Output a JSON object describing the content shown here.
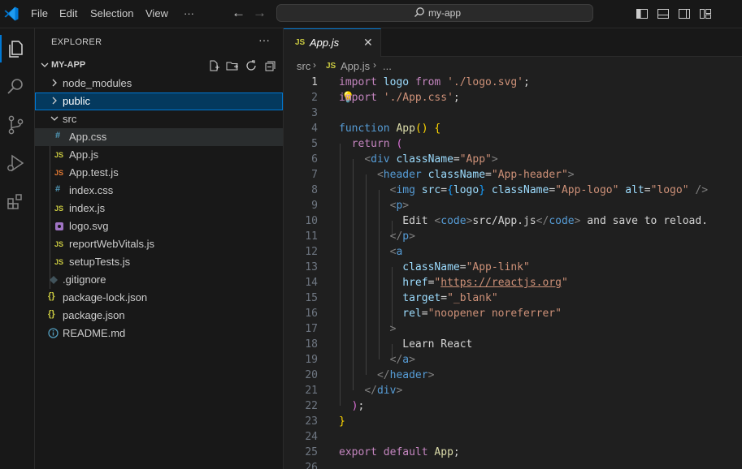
{
  "titlebar": {
    "menu": [
      "File",
      "Edit",
      "Selection",
      "View"
    ],
    "more": "···",
    "search_text": "my-app"
  },
  "explorer": {
    "title": "EXPLORER",
    "more": "···",
    "folder": "MY-APP",
    "items": [
      {
        "name": "node_modules",
        "type": "folder",
        "icon": "chevron-right"
      },
      {
        "name": "public",
        "type": "folder",
        "icon": "chevron-right"
      },
      {
        "name": "src",
        "type": "folder",
        "icon": "chevron-down"
      },
      {
        "name": "App.css",
        "type": "css",
        "icon": "#"
      },
      {
        "name": "App.js",
        "type": "js",
        "icon": "JS"
      },
      {
        "name": "App.test.js",
        "type": "test",
        "icon": "JS"
      },
      {
        "name": "index.css",
        "type": "css",
        "icon": "#"
      },
      {
        "name": "index.js",
        "type": "js",
        "icon": "JS"
      },
      {
        "name": "logo.svg",
        "type": "svg",
        "icon": "svg-icon"
      },
      {
        "name": "reportWebVitals.js",
        "type": "js",
        "icon": "JS"
      },
      {
        "name": "setupTests.js",
        "type": "js",
        "icon": "JS"
      },
      {
        "name": ".gitignore",
        "type": "git",
        "icon": "git-icon"
      },
      {
        "name": "package-lock.json",
        "type": "json",
        "icon": "{}"
      },
      {
        "name": "package.json",
        "type": "json",
        "icon": "{}"
      },
      {
        "name": "README.md",
        "type": "info",
        "icon": "info-icon"
      }
    ]
  },
  "tab": {
    "badge": "JS",
    "label": "App.js",
    "close": "✕"
  },
  "breadcrumb": {
    "folder": "src",
    "badge": "JS",
    "file": "App.js",
    "more": "..."
  },
  "editor": {
    "current_line": 1,
    "line_numbers": [
      "1",
      "2",
      "3",
      "4",
      "5",
      "6",
      "7",
      "8",
      "9",
      "10",
      "11",
      "12",
      "13",
      "14",
      "15",
      "16",
      "17",
      "18",
      "19",
      "20",
      "21",
      "22",
      "23",
      "24",
      "25",
      "26"
    ],
    "code": {
      "import_kw": "import",
      "logo_var": "logo",
      "from_kw": "from",
      "logo_path": "'./logo.svg'",
      "semi": ";",
      "import2_kw": "import",
      "css_path": "'./App.css'",
      "function_kw": "function",
      "app_fn": "App",
      "open_paren": "(",
      "close_paren": ")",
      "open_brace": "{",
      "return_kw": "return",
      "div_tag": "div",
      "classname_attr": "className",
      "app_class": "\"App\"",
      "header_tag": "header",
      "header_class": "\"App-header\"",
      "img_tag": "img",
      "src_attr": "src",
      "logo_class": "\"App-logo\"",
      "alt_attr": "alt",
      "alt_value": "\"logo\"",
      "p_tag": "p",
      "edit_text": "Edit ",
      "code_tag": "code",
      "code_text": "src/App.js",
      "save_text": " and save to reload.",
      "a_tag": "a",
      "link_class": "\"App-link\"",
      "href_attr": "href",
      "href_value": "https://reactjs.org",
      "target_attr": "target",
      "target_value": "\"_blank\"",
      "rel_attr": "rel",
      "rel_value": "\"noopener noreferrer\"",
      "learn_text": "Learn React",
      "export_kw": "export",
      "default_kw": "default",
      "app_export": "App"
    }
  }
}
